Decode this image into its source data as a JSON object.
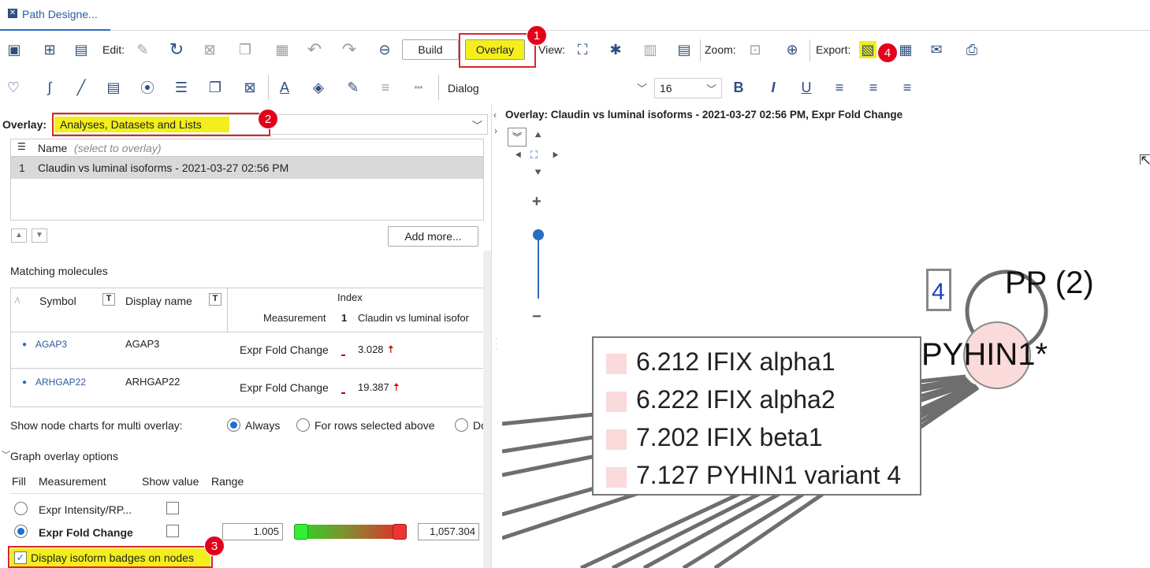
{
  "tab": {
    "title": "Path Designe..."
  },
  "toolbar1": {
    "edit_label": "Edit:",
    "build_label": "Build",
    "overlay_label": "Overlay",
    "view_label": "View:",
    "zoom_label": "Zoom:",
    "export_label": "Export:"
  },
  "toolbar2": {
    "font_name": "Dialog",
    "font_size": "16"
  },
  "callouts": [
    "1",
    "2",
    "3",
    "4"
  ],
  "overlay": {
    "label": "Overlay:",
    "selected": "Analyses, Datasets and Lists"
  },
  "list": {
    "col_name": "Name",
    "col_hint": "(select to overlay)",
    "rows": [
      {
        "num": "1",
        "name": "Claudin vs luminal isoforms - 2021-03-27 02:56 PM"
      }
    ],
    "add_more": "Add more..."
  },
  "matching": {
    "title": "Matching molecules",
    "col_symbol": "Symbol",
    "col_display": "Display name",
    "col_index": "Index",
    "col_measurement": "Measurement",
    "col_num": "1",
    "col_claudin": "Claudin vs luminal isofor",
    "rows": [
      {
        "symbol": "AGAP3",
        "display": "AGAP3",
        "measurement": "Expr Fold Change",
        "value": "3.028"
      },
      {
        "symbol": "ARHGAP22",
        "display": "ARHGAP22",
        "measurement": "Expr Fold Change",
        "value": "19.387"
      }
    ]
  },
  "node_charts": {
    "label": "Show node charts for multi overlay:",
    "opt_always": "Always",
    "opt_rows": "For rows selected above",
    "opt_do": "Do"
  },
  "graph_options": {
    "title": "Graph overlay options",
    "col_fill": "Fill",
    "col_measurement": "Measurement",
    "col_show": "Show value",
    "col_range": "Range",
    "row1": "Expr Intensity/RP...",
    "row2": "Expr Fold Change",
    "range_min": "1.005",
    "range_max": "1,057.304",
    "badges_label": "Display isoform badges on nodes"
  },
  "canvas": {
    "title": "Overlay: Claudin vs luminal isoforms - 2021-03-27 02:56 PM, Expr Fold Change",
    "badge": "4",
    "pp_label": "PP (2)",
    "node_label": "PYHIN1*",
    "legend": [
      {
        "value": "6.212",
        "name": "IFIX alpha1"
      },
      {
        "value": "6.222",
        "name": "IFIX alpha2"
      },
      {
        "value": "7.202",
        "name": "IFIX beta1"
      },
      {
        "value": "7.127",
        "name": "PYHIN1 variant 4"
      }
    ]
  },
  "colors": {
    "highlight": "#f3ee1c",
    "callout": "#e4001b",
    "node_fill": "#fadada",
    "accent": "#1c6fd6"
  }
}
